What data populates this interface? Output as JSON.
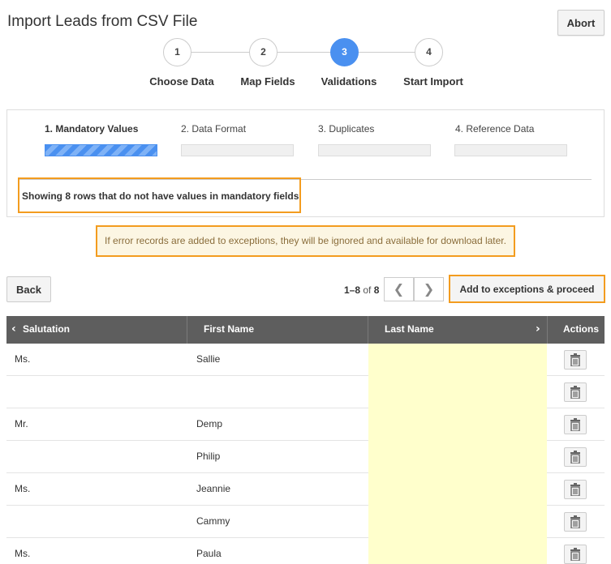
{
  "header": {
    "title": "Import Leads from CSV File",
    "abort_label": "Abort"
  },
  "wizard": {
    "current_step": 3,
    "steps": [
      {
        "number": "1",
        "label": "Choose Data"
      },
      {
        "number": "2",
        "label": "Map Fields"
      },
      {
        "number": "3",
        "label": "Validations"
      },
      {
        "number": "4",
        "label": "Start Import"
      }
    ]
  },
  "validation": {
    "active_substep": 1,
    "substeps": [
      {
        "label": "1. Mandatory Values",
        "progress": 1.0
      },
      {
        "label": "2. Data Format",
        "progress": 0
      },
      {
        "label": "3. Duplicates",
        "progress": 0
      },
      {
        "label": "4. Reference Data",
        "progress": 0
      }
    ],
    "summary": "Showing 8 rows that do not have values in mandatory fields"
  },
  "notice": "If error records are added to exceptions, they will be ignored and available for download later.",
  "toolbar": {
    "back_label": "Back",
    "pager_range": "1–8",
    "pager_of": "of",
    "pager_total": "8",
    "prev_icon": "chevron-left-icon",
    "next_icon": "chevron-right-icon",
    "proceed_label": "Add to exceptions & proceed"
  },
  "grid": {
    "columns": [
      "Salutation",
      "First Name",
      "Last Name",
      "Actions"
    ],
    "rows": [
      {
        "salutation": "Ms.",
        "first_name": "Sallie",
        "last_name": ""
      },
      {
        "salutation": "",
        "first_name": "",
        "last_name": ""
      },
      {
        "salutation": "Mr.",
        "first_name": "Demp",
        "last_name": ""
      },
      {
        "salutation": "",
        "first_name": "Philip",
        "last_name": ""
      },
      {
        "salutation": "Ms.",
        "first_name": "Jeannie",
        "last_name": ""
      },
      {
        "salutation": "",
        "first_name": "Cammy",
        "last_name": ""
      },
      {
        "salutation": "Ms.",
        "first_name": "Paula",
        "last_name": ""
      }
    ],
    "row_action_icon": "trash-icon"
  },
  "colors": {
    "accent": "#4a90f0",
    "highlight_border": "#f39c1f",
    "missing_value_bg": "#ffffcc",
    "header_bg": "#5e5e5e"
  }
}
